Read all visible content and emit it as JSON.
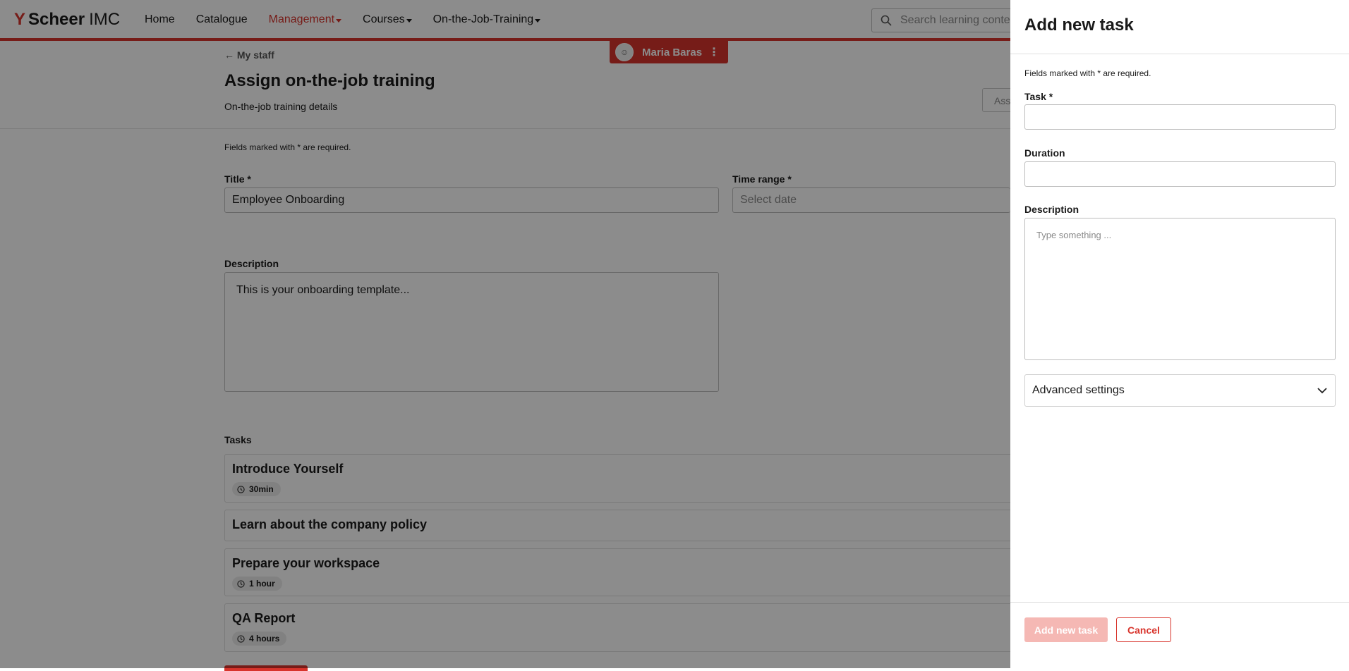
{
  "app": {
    "logo_mark": "Y",
    "brand_bold": "Scheer",
    "brand_light": "IMC",
    "accent_color": "#d8342c"
  },
  "nav": {
    "items": [
      {
        "label": "Home",
        "active": false,
        "dropdown": false
      },
      {
        "label": "Catalogue",
        "active": false,
        "dropdown": false
      },
      {
        "label": "Management",
        "active": true,
        "dropdown": true
      },
      {
        "label": "Courses",
        "active": false,
        "dropdown": true
      },
      {
        "label": "On-the-Job-Training",
        "active": false,
        "dropdown": true
      }
    ],
    "search_placeholder": "Search learning conte"
  },
  "header": {
    "back_link": "← My staff",
    "user_name": "Maria Baras",
    "title": "Assign on-the-job training",
    "subtitle": "On-the-job training details",
    "assign_button": "Ass"
  },
  "form": {
    "required_note": "Fields marked with * are required.",
    "title_label": "Title *",
    "title_value": "Employee Onboarding",
    "time_range_label": "Time range *",
    "time_range_placeholder": "Select date",
    "description_label": "Description",
    "description_value": "This is your onboarding template...",
    "tasks_label": "Tasks",
    "tasks": [
      {
        "title": "Introduce Yourself",
        "duration": "30min"
      },
      {
        "title": "Learn about the company policy",
        "duration": ""
      },
      {
        "title": "Prepare your workspace",
        "duration": "1 hour"
      },
      {
        "title": "QA Report",
        "duration": "4 hours"
      }
    ]
  },
  "drawer": {
    "title": "Add new task",
    "required_note": "Fields marked with * are required.",
    "task_label": "Task *",
    "task_value": "",
    "duration_label": "Duration",
    "duration_value": "",
    "description_label": "Description",
    "description_placeholder": "Type something ...",
    "advanced_settings": "Advanced settings",
    "add_button": "Add new task",
    "cancel_button": "Cancel"
  }
}
